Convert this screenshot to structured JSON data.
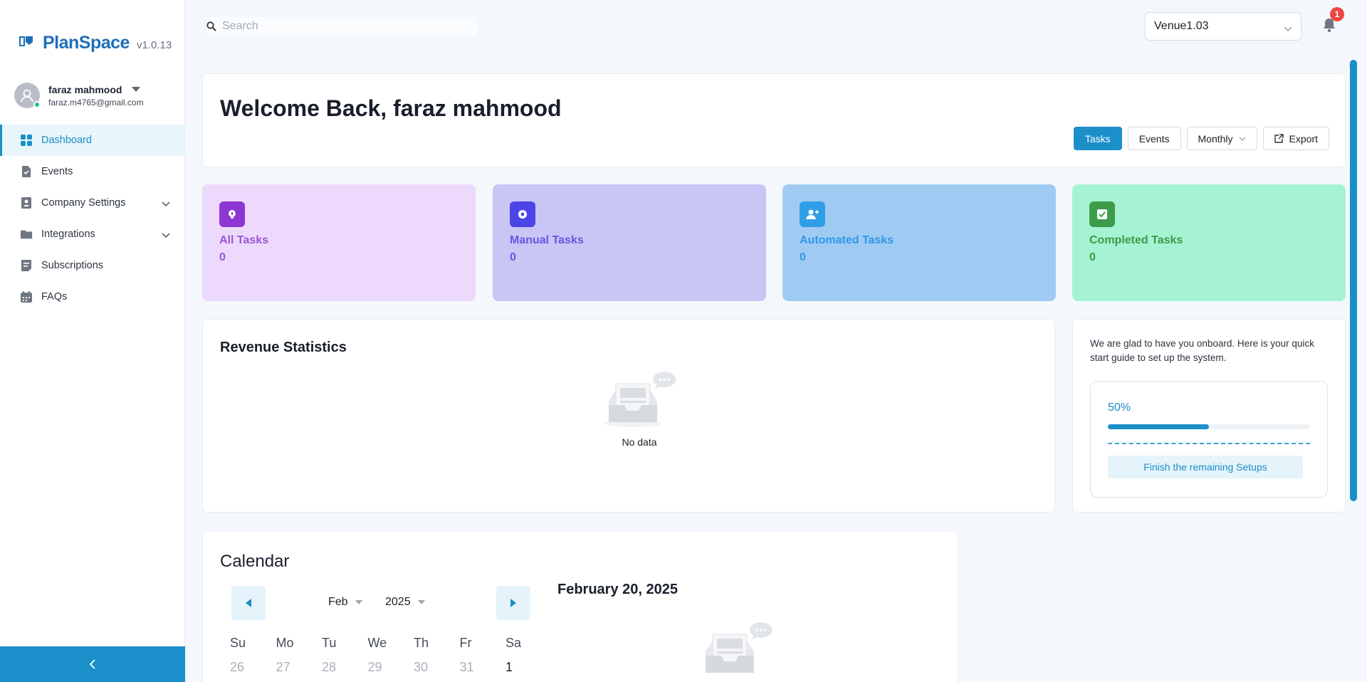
{
  "brand": {
    "name": "PlanSpace",
    "version": "v1.0.13"
  },
  "user": {
    "name": "faraz mahmood",
    "email": "faraz.m4765@gmail.com"
  },
  "sidebar": {
    "items": [
      {
        "label": "Dashboard",
        "icon": "dashboard-icon"
      },
      {
        "label": "Events",
        "icon": "events-icon"
      },
      {
        "label": "Company Settings",
        "icon": "company-settings-icon"
      },
      {
        "label": "Integrations",
        "icon": "folder-icon"
      },
      {
        "label": "Subscriptions",
        "icon": "subscriptions-icon"
      },
      {
        "label": "FAQs",
        "icon": "calendar-icon"
      }
    ]
  },
  "search": {
    "placeholder": "Search"
  },
  "venue": {
    "selected": "Venue1.03"
  },
  "notifications": {
    "count": "1"
  },
  "welcome": {
    "title": "Welcome Back, faraz mahmood"
  },
  "toolbar": {
    "tasks": "Tasks",
    "events": "Events",
    "period": "Monthly",
    "export": "Export"
  },
  "stats": [
    {
      "label": "All Tasks",
      "value": "0",
      "bg": "#ecd9fb",
      "icon_bg": "#8d36d2",
      "text": "#9b54d6"
    },
    {
      "label": "Manual Tasks",
      "value": "0",
      "bg": "#c9c5f5",
      "icon_bg": "#4b44e6",
      "text": "#6258e0"
    },
    {
      "label": "Automated Tasks",
      "value": "0",
      "bg": "#9fcbf3",
      "icon_bg": "#2f9ee8",
      "text": "#2f97e6"
    },
    {
      "label": "Completed Tasks",
      "value": "0",
      "bg": "#a5f3d2",
      "icon_bg": "#3d9c4a",
      "text": "#3b9a48"
    }
  ],
  "revenue": {
    "title": "Revenue Statistics",
    "empty": "No data"
  },
  "onboarding": {
    "text": "We are glad to have you onboard. Here is your quick start guide to set up the system.",
    "percent_label": "50%",
    "progress": 0.5,
    "button": "Finish the remaining Setups"
  },
  "calendar": {
    "title": "Calendar",
    "month": "Feb",
    "year": "2025",
    "selected_date": "February 20, 2025",
    "weekdays": [
      "Su",
      "Mo",
      "Tu",
      "We",
      "Th",
      "Fr",
      "Sa"
    ],
    "days": [
      "26",
      "27",
      "28",
      "29",
      "30",
      "31",
      "1"
    ]
  },
  "colors": {
    "accent": "#1b8fc9"
  }
}
